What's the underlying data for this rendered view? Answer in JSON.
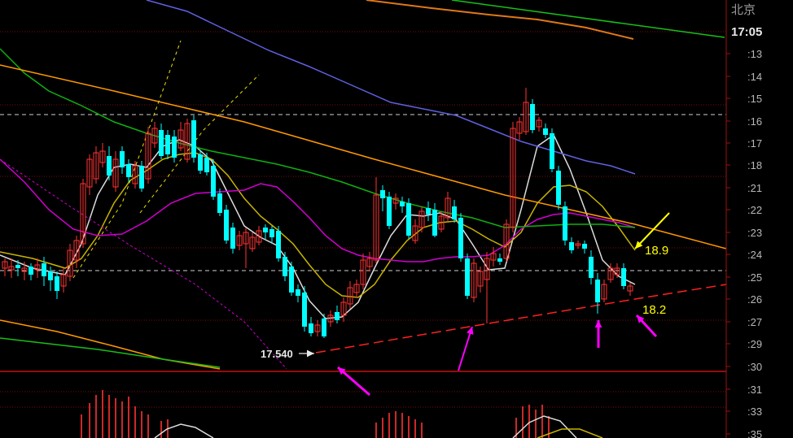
{
  "header": {
    "region": "北京",
    "time": "17:05"
  },
  "chart_data": {
    "type": "candlestick",
    "y_axis_labels": [
      ":13",
      ":14",
      ":15",
      ":16",
      ":17",
      ":18",
      ":21",
      ":22",
      ":23",
      ":24",
      ":25",
      ":26",
      ":27",
      ":29",
      ":30",
      ":31",
      ":33",
      ":35"
    ],
    "annotations": [
      {
        "name": "label-18-9",
        "text": "18.9",
        "color": "#ffff00"
      },
      {
        "name": "label-18-2",
        "text": "18.2",
        "color": "#ffff00"
      },
      {
        "name": "label-17-540",
        "text": "17.540",
        "color": "#e8e8e8"
      }
    ],
    "colors": {
      "up": "#ff3333",
      "down": "#00ffff",
      "ma_white": "#dcdcdc",
      "ma_yellow": "#c8b400",
      "ma_magenta": "#d000d0",
      "ma_green": "#10b010",
      "ma_blue": "#6060e0",
      "trend_orange": "#ff9900",
      "support_red": "#ff2020",
      "arrow_magenta": "#ff00ff"
    }
  }
}
